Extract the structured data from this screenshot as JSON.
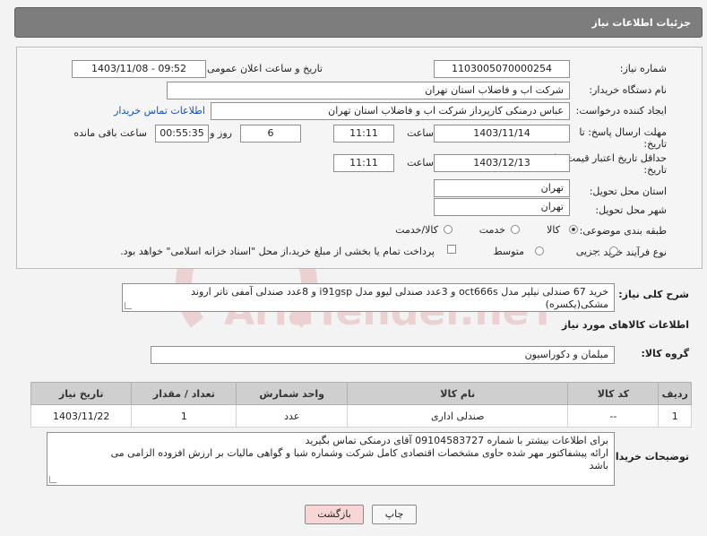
{
  "header": {
    "title": "جزئیات اطلاعات نیاز"
  },
  "form": {
    "need_number": {
      "label": "شماره نیاز:",
      "value": "1103005070000254"
    },
    "announce": {
      "label": "تاریخ و ساعت اعلان عمومی:",
      "value": "1403/11/08 - 09:52"
    },
    "buyer_org": {
      "label": "نام دستگاه خریدار:",
      "value": "شرکت اب و فاضلاب استان تهران"
    },
    "creator": {
      "label": "ایجاد کننده درخواست:",
      "value": "عباس درمنکی کارپرداز شرکت اب و فاضلاب استان تهران",
      "link": "اطلاعات تماس خریدار"
    },
    "reply_deadline": {
      "label1": "مهلت ارسال پاسخ: تا",
      "label2": "تاریخ:",
      "date": "1403/11/14",
      "time_label": "ساعت",
      "time": "11:11",
      "days": "6",
      "days_label": "روز و",
      "remaining": "00:55:35",
      "remaining_label": "ساعت باقی مانده"
    },
    "price_validity": {
      "label1": "حداقل تاریخ اعتبار قیمت: تا",
      "label2": "تاریخ:",
      "date": "1403/12/13",
      "time_label": "ساعت",
      "time": "11:11"
    },
    "province": {
      "label": "استان محل تحویل:",
      "value": "تهران"
    },
    "city": {
      "label": "شهر محل تحویل:",
      "value": "تهران"
    },
    "category": {
      "label": "طبقه بندی موضوعی:",
      "options": [
        "کالا",
        "خدمت",
        "کالا/خدمت"
      ]
    },
    "purchase_type": {
      "label": "نوع فرآیند خرید :",
      "options": [
        "جزیی",
        "متوسط"
      ],
      "payment_note": "پرداخت تمام یا بخشی از مبلغ خرید،از محل \"اسناد خزانه اسلامی\" خواهد بود."
    }
  },
  "description": {
    "label": "شرح کلی نیاز:",
    "line1": "خرید 67 صندلی نیلپر مدل oct666s و 3عدد صندلی لیوو مدل i91gsp و 8عدد صندلی آمفی تاتر اروند",
    "line2": "مشکی(یکسره)"
  },
  "goods_section": {
    "title": "اطلاعات کالاهای مورد نیاز"
  },
  "goods_group": {
    "label": "گروه کالا:",
    "value": "مبلمان و دکوراسیون"
  },
  "table": {
    "headers": [
      "ردیف",
      "کد کالا",
      "نام کالا",
      "واحد شمارش",
      "تعداد / مقدار",
      "تاریخ نیاز"
    ],
    "rows": [
      [
        "1",
        "--",
        "صندلی اداری",
        "عدد",
        "1",
        "1403/11/22"
      ]
    ]
  },
  "buyer_notes": {
    "label": "توضیحات خریدار:",
    "line1": "برای اطلاعات بیشتر با شماره 09104583727 آقای درمنکی تماس بگیرید",
    "line2": "ارائه پیشفاکتور مهر شده حاوی مشخصات اقتصادی کامل شرکت وشماره شبا  و گواهی مالیات بر ارزش افزوده الزامی می",
    "line3": "باشد"
  },
  "buttons": {
    "print": "چاپ",
    "back": "بازگشت"
  },
  "watermark": {
    "text": "AriaTender.neT"
  },
  "colors": {
    "header_bg": "#7d7d7d",
    "link": "#1a4fb3",
    "back_button_bg": "#f8d6d6"
  }
}
